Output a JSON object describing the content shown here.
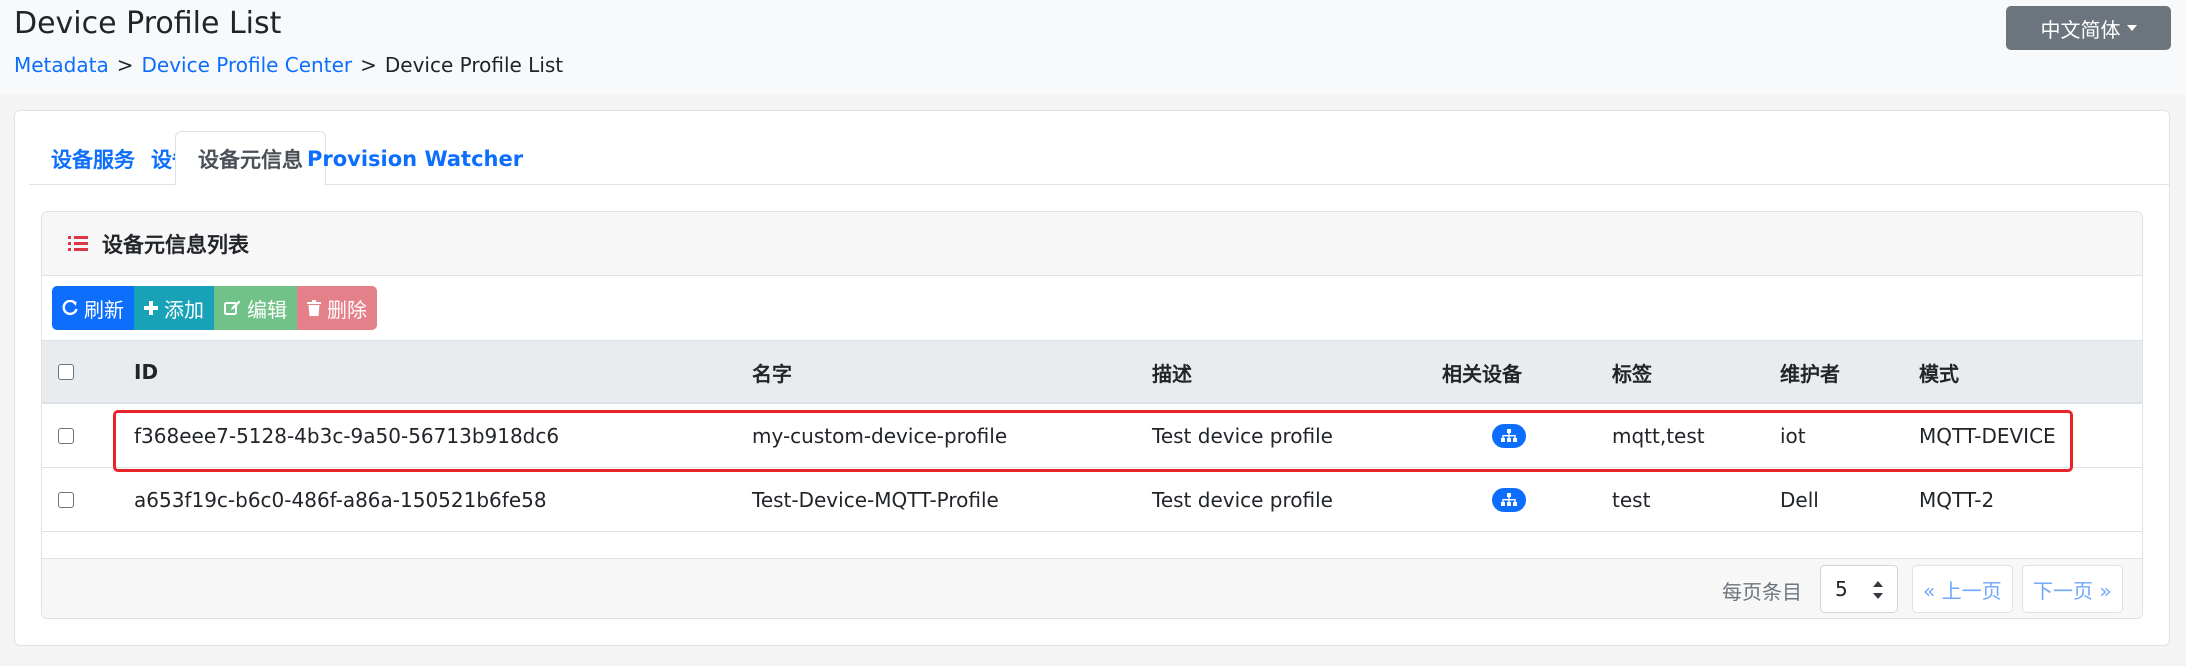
{
  "header": {
    "title": "Device Profile List",
    "breadcrumb": [
      "Metadata",
      "Device Profile Center",
      "Device Profile List"
    ],
    "separator": ">",
    "language_button": "中文简体"
  },
  "tabs": [
    {
      "label": "设备服务",
      "active": false
    },
    {
      "label": "设备",
      "active": false
    },
    {
      "label": "设备元信息",
      "active": true
    },
    {
      "label": "Provision Watcher",
      "active": false
    }
  ],
  "panel": {
    "title": "设备元信息列表",
    "toolbar": {
      "refresh": "刷新",
      "add": "添加",
      "edit": "编辑",
      "delete": "删除"
    }
  },
  "table": {
    "columns": [
      "ID",
      "名字",
      "描述",
      "相关设备",
      "标签",
      "维护者",
      "模式"
    ],
    "rows": [
      {
        "id": "f368eee7-5128-4b3c-9a50-56713b918dc6",
        "name": "my-custom-device-profile",
        "description": "Test device profile",
        "labels": "mqtt,test",
        "manufacturer": "iot",
        "model": "MQTT-DEVICE",
        "highlighted": true
      },
      {
        "id": "a653f19c-b6c0-486f-a86a-150521b6fe58",
        "name": "Test-Device-MQTT-Profile",
        "description": "Test device profile",
        "labels": "test",
        "manufacturer": "Dell",
        "model": "MQTT-2",
        "highlighted": false
      }
    ]
  },
  "pagination": {
    "per_page_label": "每页条目",
    "per_page_value": "5",
    "prev": "« 上一页",
    "next": "下一页 »"
  },
  "colors": {
    "primary": "#0d6efd",
    "info": "#17a2b8",
    "success": "#71c288",
    "danger": "#e4808a",
    "highlight_border": "#e8232a"
  }
}
